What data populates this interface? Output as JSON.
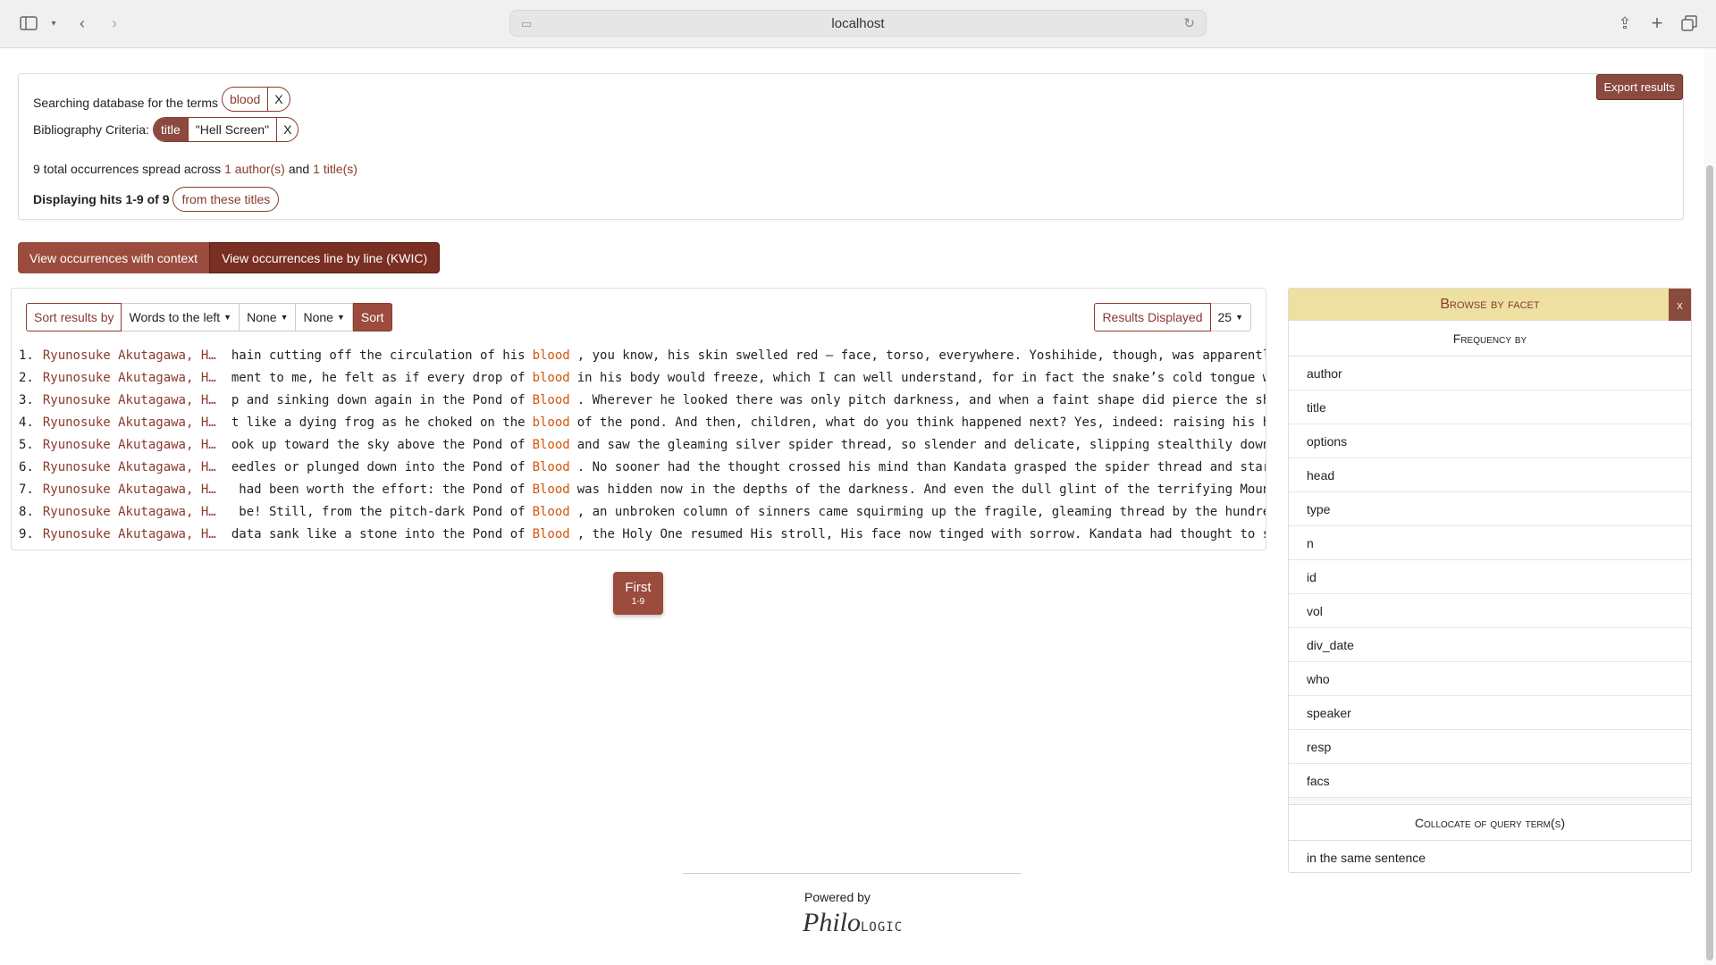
{
  "browser": {
    "url": "localhost"
  },
  "search": {
    "searching_label": "Searching database for the terms",
    "term": "blood",
    "remove": "X",
    "biblio_label": "Bibliography Criteria:",
    "biblio_key": "title",
    "biblio_value": "\"Hell Screen\"",
    "summary_prefix": "9 total occurrences spread across",
    "authors_link": "1 author(s)",
    "and": "and",
    "titles_link": "1 title(s)",
    "displaying": "Displaying hits 1-9 of 9",
    "from_titles": "from these titles",
    "export": "Export results"
  },
  "views": {
    "context": "View occurrences with context",
    "kwic": "View occurrences line by line (KWIC)"
  },
  "sort": {
    "label": "Sort results by",
    "option1": "Words to the left",
    "option2": "None",
    "option3": "None",
    "button": "Sort",
    "results_displayed": "Results Displayed",
    "per_page": "25"
  },
  "kwic": [
    {
      "idx": "1.",
      "author": "Ryunosuke Akutagawa, H…",
      "left": "hain cutting off the circulation of his",
      "hit": "blood",
      "right": ", you know, his skin swelled red — face, torso, everywhere. Yoshihide, though, was apparently"
    },
    {
      "idx": "2.",
      "author": "Ryunosuke Akutagawa, H…",
      "left": "ment to me, he felt as if every drop of",
      "hit": "blood",
      "right": "in his body would freeze, which I can well understand, for in fact the snake’s cold tongue was"
    },
    {
      "idx": "3.",
      "author": "Ryunosuke Akutagawa, H…",
      "left": "p and sinking down again in the Pond of",
      "hit": "Blood",
      "right": ". Wherever he looked there was only pitch darkness, and when a faint shape did pierce the shadows"
    },
    {
      "idx": "4.",
      "author": "Ryunosuke Akutagawa, H…",
      "left": "t like a dying frog as he choked on the",
      "hit": "blood",
      "right": "of the pond. And then, children, what do you think happened next? Yes, indeed: raising his head"
    },
    {
      "idx": "5.",
      "author": "Ryunosuke Akutagawa, H…",
      "left": "ook up toward the sky above the Pond of",
      "hit": "Blood",
      "right": "and saw the gleaming silver spider thread, so slender and delicate, slipping stealthily down"
    },
    {
      "idx": "6.",
      "author": "Ryunosuke Akutagawa, H…",
      "left": "eedles or plunged down into the Pond of",
      "hit": "Blood",
      "right": ". No sooner had the thought crossed his mind than Kandata grasped the spider thread and started"
    },
    {
      "idx": "7.",
      "author": "Ryunosuke Akutagawa, H…",
      "left": "had been worth the effort: the Pond of",
      "hit": "Blood",
      "right": "was hidden now in the depths of the darkness. And even the dull glint of the terrifying Mountain"
    },
    {
      "idx": "8.",
      "author": "Ryunosuke Akutagawa, H…",
      "left": "be! Still, from the pitch-dark Pond of",
      "hit": "Blood",
      "right": ", an unbroken column of sinners came squirming up the fragile, gleaming thread by the hundreds"
    },
    {
      "idx": "9.",
      "author": "Ryunosuke Akutagawa, H…",
      "left": "data sank like a stone into the Pond of",
      "hit": "Blood",
      "right": ", the Holy One resumed His stroll, His face now tinged with sorrow. Kandata had thought to save"
    }
  ],
  "pager": {
    "label": "First",
    "range": "1-9"
  },
  "facets": {
    "title": "Browse by facet",
    "close": "x",
    "frequency_by": "Frequency by",
    "items": [
      "author",
      "title",
      "options",
      "head",
      "type",
      "n",
      "id",
      "vol",
      "div_date",
      "who",
      "speaker",
      "resp",
      "facs"
    ],
    "collocate_title": "Collocate of query term(s)",
    "collocate_item": "in the same sentence"
  },
  "footer": {
    "powered_by": "Powered by",
    "logo_philo": "Philo",
    "logo_logic": "LOGIC"
  }
}
